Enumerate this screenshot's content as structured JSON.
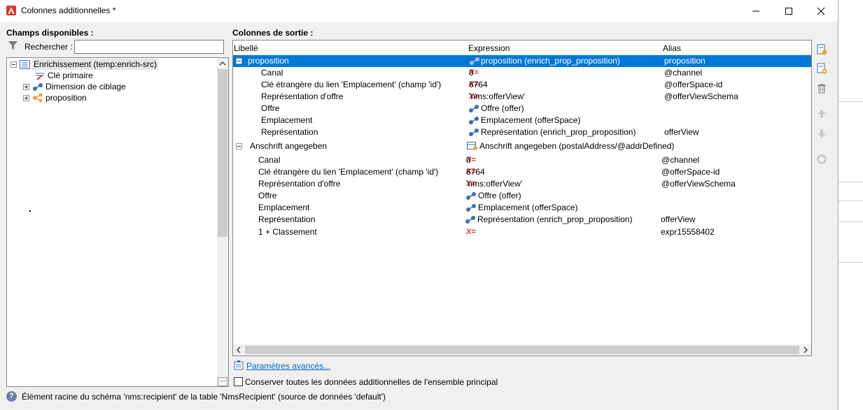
{
  "window": {
    "title": "Colonnes additionnelles *",
    "controls": {
      "minimize": "minimize-icon",
      "maximize": "maximize-icon",
      "close": "close-icon"
    }
  },
  "left": {
    "header": "Champs disponibles :",
    "search_label": "Rechercher :",
    "search_value": "",
    "tree": [
      {
        "label": "Enrichissement (temp:enrich-src)",
        "icon": "schema-list-icon",
        "expanded": true
      },
      {
        "label": "Clé primaire",
        "icon": "primary-key-icon"
      },
      {
        "label": "Dimension de ciblage",
        "icon": "link-icon",
        "expanded": false
      },
      {
        "label": "proposition",
        "icon": "collection-icon",
        "expanded": false
      }
    ]
  },
  "right": {
    "header": "Colonnes de sortie :",
    "columns": [
      "Libellé",
      "Expression",
      "Alias"
    ],
    "rows": [
      {
        "label": "proposition",
        "expr": "proposition (enrich_prop_proposition)",
        "alias": "proposition",
        "expr_icon": "link-icon",
        "selected": true,
        "group": true
      },
      {
        "label": "Canal",
        "expr": "0",
        "alias": "@channel",
        "expr_icon": "expression-icon"
      },
      {
        "label": "Clé étrangère du lien 'Emplacement' (champ 'id')",
        "expr": "6764",
        "alias": "@offerSpace-id",
        "expr_icon": "expression-icon"
      },
      {
        "label": "Représentation d'offre",
        "expr": "'nms:offerView'",
        "alias": "@offerViewSchema",
        "expr_icon": "expression-icon"
      },
      {
        "label": "Offre",
        "expr": "Offre (offer)",
        "alias": "",
        "expr_icon": "link-icon"
      },
      {
        "label": "Emplacement",
        "expr": "Emplacement (offerSpace)",
        "alias": "",
        "expr_icon": "link-icon"
      },
      {
        "label": "Représentation",
        "expr": "Représentation (enrich_prop_proposition)",
        "alias": "offerView",
        "expr_icon": "link-icon"
      },
      {
        "label": "Anschrift angegeben",
        "expr": "Anschrift angegeben (postalAddress/@addrDefined)",
        "alias": "",
        "expr_icon": "table-gear-icon",
        "group": true
      },
      {
        "label": "Canal",
        "expr": "0",
        "alias": "@channel",
        "expr_icon": "expression-icon"
      },
      {
        "label": "Clé étrangère du lien 'Emplacement' (champ 'id')",
        "expr": "6764",
        "alias": "@offerSpace-id",
        "expr_icon": "expression-icon"
      },
      {
        "label": "Représentation d'offre",
        "expr": "'nms:offerView'",
        "alias": "@offerViewSchema",
        "expr_icon": "expression-icon"
      },
      {
        "label": "Offre",
        "expr": "Offre (offer)",
        "alias": "",
        "expr_icon": "link-icon"
      },
      {
        "label": "Emplacement",
        "expr": "Emplacement (offerSpace)",
        "alias": "",
        "expr_icon": "link-icon"
      },
      {
        "label": "Représentation",
        "expr": "Représentation (enrich_prop_proposition)",
        "alias": "offerView",
        "expr_icon": "link-icon"
      },
      {
        "label": "1 + Classement",
        "expr": "",
        "alias": "expr15558402",
        "expr_icon": "expression-icon"
      }
    ],
    "expr_symbol": "X=",
    "toolbar": [
      "add-column-icon",
      "add-expression-icon",
      "delete-icon",
      "move-up-icon",
      "move-down-icon",
      "refresh-icon"
    ]
  },
  "advanced_link": "Paramètres avancés...",
  "keep_data_label": "Conserver toutes les données additionnelles de l'ensemble principal",
  "keep_data_checked": false,
  "status": "Élément racine du schéma 'nms:recipient' de la table 'NmsRecipient' (source de données 'default')",
  "colors": {
    "selection": "#0078d7",
    "link": "#0066cc",
    "expression": "#e0302a",
    "logo": "#e8322d"
  }
}
